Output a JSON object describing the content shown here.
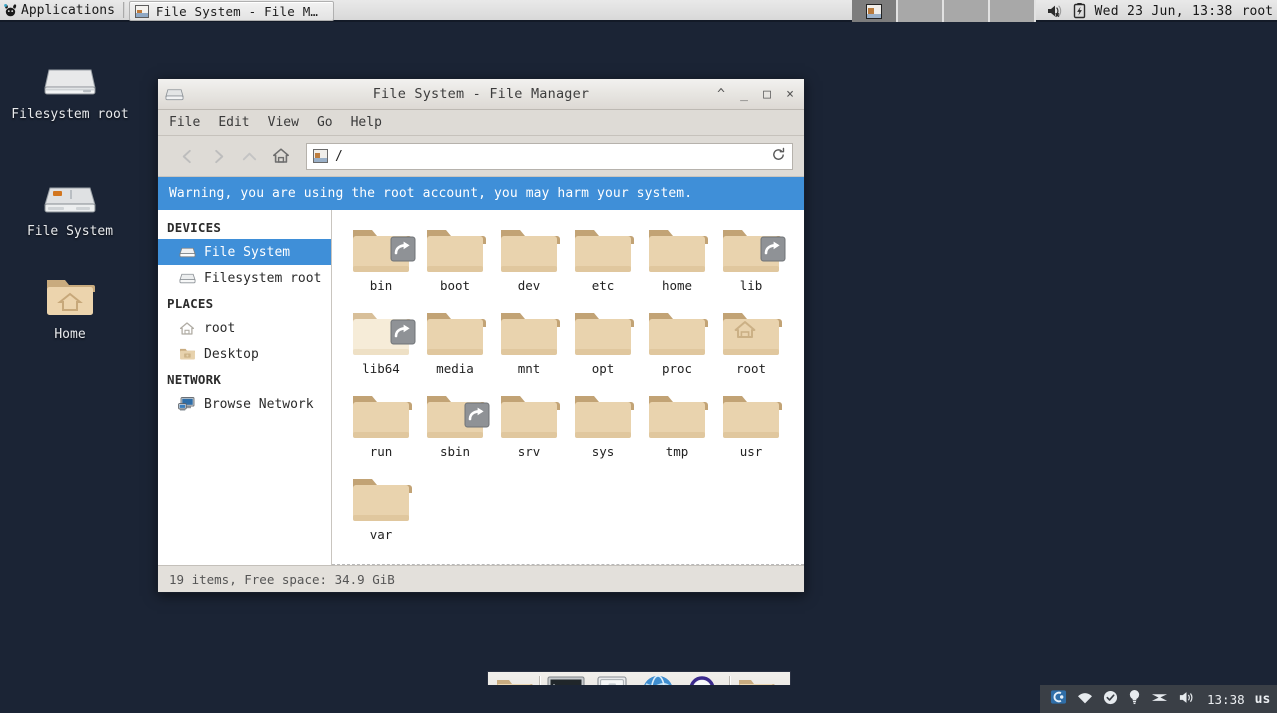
{
  "top_panel": {
    "applications_label": "Applications",
    "applications_icon": "xfce-mouse-icon",
    "task_button": {
      "label": "File System - File M…",
      "icon": "window-thumbnail-icon"
    },
    "workspaces": {
      "count": 4,
      "active_index": 0
    },
    "tray": {
      "volume_icon": "speaker-muted-icon",
      "battery_icon": "battery-charging-icon",
      "clock": "Wed 23 Jun, 13:38",
      "user": "root"
    },
    "background": "#e2e2e2"
  },
  "desktop": {
    "background": "#1b2435",
    "icons": [
      {
        "name": "Filesystem root",
        "icon": "drive-harddisk-icon"
      },
      {
        "name": "File System",
        "icon": "drive-removable-icon"
      },
      {
        "name": "Home",
        "icon": "user-home-folder-icon"
      }
    ]
  },
  "file_manager": {
    "title": "File System - File Manager",
    "window_icon": "drive-harddisk-icon",
    "window_buttons": {
      "shade": "^",
      "minimize": "_",
      "maximize": "□",
      "close": "×"
    },
    "menu": [
      "File",
      "Edit",
      "View",
      "Go",
      "Help"
    ],
    "toolbar": {
      "back": "back-arrow-icon",
      "forward": "forward-arrow-icon",
      "up": "up-arrow-icon",
      "home": "home-icon",
      "reload": "reload-icon"
    },
    "path": {
      "value": "/",
      "icon": "filesystem-icon"
    },
    "warning": "Warning, you are using the root account, you may harm your system.",
    "warning_color": "#3f8fd8",
    "sidebar": [
      {
        "header": "DEVICES",
        "items": [
          {
            "label": "File System",
            "icon": "drive-icon",
            "selected": true
          },
          {
            "label": "Filesystem root",
            "icon": "drive-icon",
            "selected": false
          }
        ]
      },
      {
        "header": "PLACES",
        "items": [
          {
            "label": "root",
            "icon": "home-icon",
            "selected": false
          },
          {
            "label": "Desktop",
            "icon": "desktop-folder-icon",
            "selected": false
          }
        ]
      },
      {
        "header": "NETWORK",
        "items": [
          {
            "label": "Browse Network",
            "icon": "network-computer-icon",
            "selected": false
          }
        ]
      }
    ],
    "files": [
      {
        "name": "bin",
        "emblem": "symlink",
        "highlight": false
      },
      {
        "name": "boot",
        "emblem": "",
        "highlight": false
      },
      {
        "name": "dev",
        "emblem": "",
        "highlight": false
      },
      {
        "name": "etc",
        "emblem": "",
        "highlight": false
      },
      {
        "name": "home",
        "emblem": "",
        "highlight": false
      },
      {
        "name": "lib",
        "emblem": "symlink",
        "highlight": false
      },
      {
        "name": "lib64",
        "emblem": "symlink",
        "highlight": true
      },
      {
        "name": "media",
        "emblem": "",
        "highlight": false
      },
      {
        "name": "mnt",
        "emblem": "",
        "highlight": false
      },
      {
        "name": "opt",
        "emblem": "",
        "highlight": false
      },
      {
        "name": "proc",
        "emblem": "",
        "highlight": false
      },
      {
        "name": "root",
        "emblem": "home",
        "highlight": false
      },
      {
        "name": "run",
        "emblem": "",
        "highlight": false
      },
      {
        "name": "sbin",
        "emblem": "symlink",
        "highlight": false
      },
      {
        "name": "srv",
        "emblem": "",
        "highlight": false
      },
      {
        "name": "sys",
        "emblem": "",
        "highlight": false
      },
      {
        "name": "tmp",
        "emblem": "",
        "highlight": false
      },
      {
        "name": "usr",
        "emblem": "",
        "highlight": false
      },
      {
        "name": "var",
        "emblem": "",
        "highlight": false
      }
    ],
    "status": "19 items, Free space: 34.9 GiB"
  },
  "dock": {
    "items": [
      {
        "icon": "folder-desktop-icon"
      },
      {
        "icon": "separator"
      },
      {
        "icon": "terminal-icon"
      },
      {
        "icon": "file-manager-icon"
      },
      {
        "icon": "web-browser-icon"
      },
      {
        "icon": "find-files-icon"
      },
      {
        "icon": "separator"
      },
      {
        "icon": "folder-icon"
      }
    ]
  },
  "bottom_tray": {
    "icons": [
      "app-indicator-icon",
      "wifi-icon",
      "updates-ok-icon",
      "tips-icon",
      "network-activity-icon",
      "volume-icon"
    ],
    "clock": "13:38",
    "keyboard_layout": "us"
  }
}
